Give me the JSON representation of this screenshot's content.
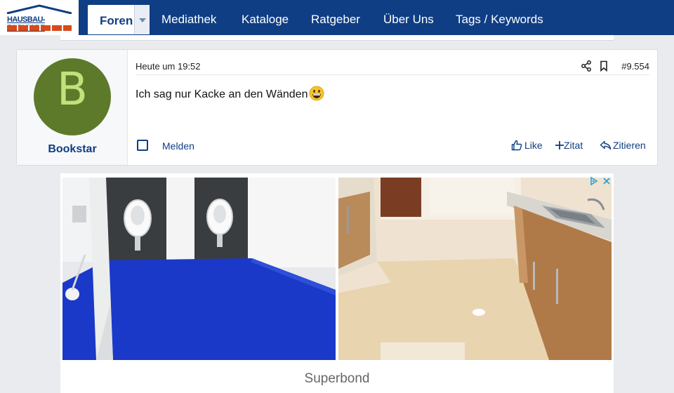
{
  "header": {
    "logo_text": "HAUSBAU-FORUM.DE",
    "nav_active": "Foren",
    "nav_items": [
      "Mediathek",
      "Kataloge",
      "Ratgeber",
      "Über Uns",
      "Tags / Keywords"
    ]
  },
  "post": {
    "avatar_letter": "B",
    "username": "Bookstar",
    "timestamp": "Heute um 19:52",
    "post_number": "#9.554",
    "message": "Ich sag nur Kacke an den Wänden",
    "emoji": "grinning-face-emoji",
    "report_label": "Melden",
    "actions": {
      "like": "Like",
      "quote": "Zitat",
      "cite": "Zitieren"
    }
  },
  "ad": {
    "caption": "Superbond",
    "icons": [
      "adchoices-icon",
      "close-icon"
    ]
  },
  "colors": {
    "nav_bg": "#0f3e84",
    "link": "#0f3e84",
    "avatar_bg": "#5d7a2a",
    "avatar_letter": "#c2e17a"
  }
}
